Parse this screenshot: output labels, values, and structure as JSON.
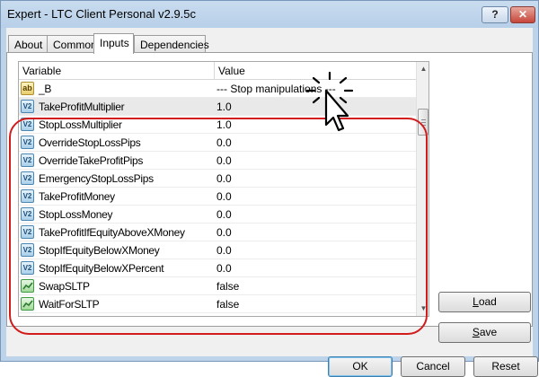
{
  "window": {
    "title": "Expert - LTC Client Personal v2.9.5c",
    "help_glyph": "?",
    "close_glyph": "✕"
  },
  "tabs": [
    {
      "label": "About"
    },
    {
      "label": "Common"
    },
    {
      "label": "Inputs",
      "active": true
    },
    {
      "label": "Dependencies"
    }
  ],
  "grid": {
    "headers": {
      "variable": "Variable",
      "value": "Value"
    },
    "rows": [
      {
        "icon": "string-icon",
        "icon_text": "ab",
        "name": "_B",
        "value": "--- Stop manipulations ---"
      },
      {
        "icon": "double-icon",
        "icon_text": "V2",
        "name": "TakeProfitMultiplier",
        "value": "1.0"
      },
      {
        "icon": "double-icon",
        "icon_text": "V2",
        "name": "StopLossMultiplier",
        "value": "1.0"
      },
      {
        "icon": "double-icon",
        "icon_text": "V2",
        "name": "OverrideStopLossPips",
        "value": "0.0"
      },
      {
        "icon": "double-icon",
        "icon_text": "V2",
        "name": "OverrideTakeProfitPips",
        "value": "0.0"
      },
      {
        "icon": "double-icon",
        "icon_text": "V2",
        "name": "EmergencyStopLossPips",
        "value": "0.0"
      },
      {
        "icon": "double-icon",
        "icon_text": "V2",
        "name": "TakeProfitMoney",
        "value": "0.0"
      },
      {
        "icon": "double-icon",
        "icon_text": "V2",
        "name": "StopLossMoney",
        "value": "0.0"
      },
      {
        "icon": "double-icon",
        "icon_text": "V2",
        "name": "TakeProfitIfEquityAboveXMoney",
        "value": "0.0"
      },
      {
        "icon": "double-icon",
        "icon_text": "V2",
        "name": "StopIfEquityBelowXMoney",
        "value": "0.0"
      },
      {
        "icon": "double-icon",
        "icon_text": "V2",
        "name": "StopIfEquityBelowXPercent",
        "value": "0.0"
      },
      {
        "icon": "bool-icon",
        "icon_text": "",
        "name": "SwapSLTP",
        "value": "false"
      },
      {
        "icon": "bool-icon",
        "icon_text": "",
        "name": "WaitForSLTP",
        "value": "false"
      }
    ]
  },
  "buttons": {
    "load": "Load",
    "load_key": "L",
    "load_rest": "oad",
    "save": "Save",
    "save_key": "S",
    "save_rest": "ave",
    "ok": "OK",
    "cancel": "Cancel",
    "reset": "Reset"
  },
  "colors": {
    "highlight": "#d21b1b",
    "titlebar": "#bcd3ea",
    "selected_row": "#e9e9e9"
  }
}
